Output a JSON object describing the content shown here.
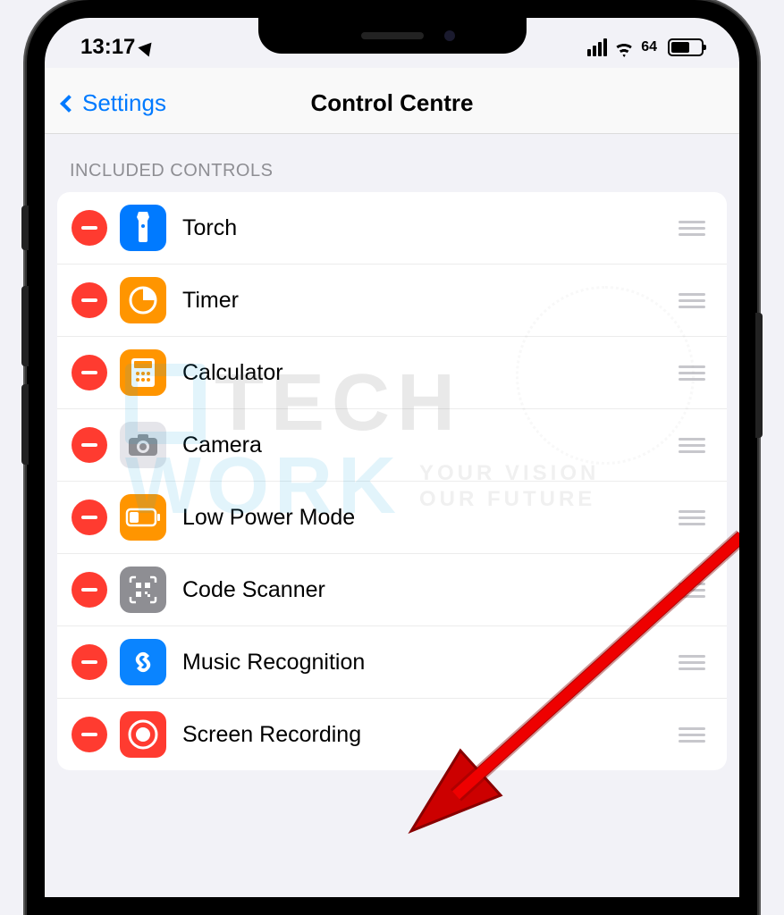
{
  "status": {
    "time": "13:17",
    "battery_text": "64",
    "battery_level_pct": 64
  },
  "nav": {
    "back_label": "Settings",
    "title": "Control Centre"
  },
  "section": {
    "header": "INCLUDED CONTROLS",
    "items": [
      {
        "label": "Torch",
        "icon": "torch-icon",
        "icon_bg": "#007aff"
      },
      {
        "label": "Timer",
        "icon": "timer-icon",
        "icon_bg": "#ff9500"
      },
      {
        "label": "Calculator",
        "icon": "calculator-icon",
        "icon_bg": "#ff9500"
      },
      {
        "label": "Camera",
        "icon": "camera-icon",
        "icon_bg": "#e5e5ea"
      },
      {
        "label": "Low Power Mode",
        "icon": "battery-icon",
        "icon_bg": "#ff9500"
      },
      {
        "label": "Code Scanner",
        "icon": "qr-icon",
        "icon_bg": "#8e8e93"
      },
      {
        "label": "Music Recognition",
        "icon": "shazam-icon",
        "icon_bg": "#0a84ff"
      },
      {
        "label": "Screen Recording",
        "icon": "record-icon",
        "icon_bg": "#ff3b30"
      }
    ]
  },
  "watermark": {
    "line1": "TECH",
    "line2": "WORK",
    "tag1": "YOUR VISION",
    "tag2": "OUR FUTURE"
  }
}
